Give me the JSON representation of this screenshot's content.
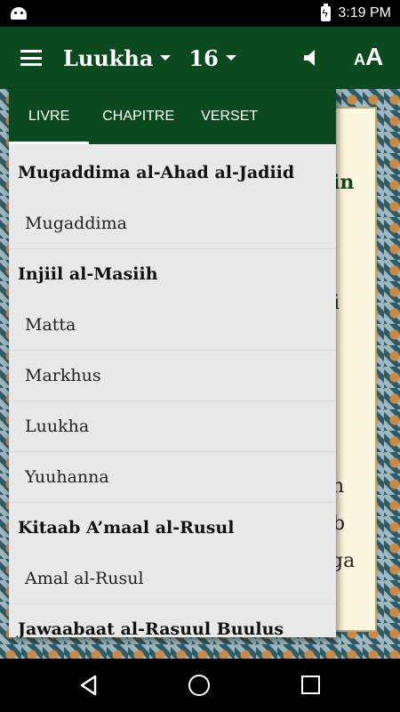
{
  "status_bar": {
    "time": "3:19 PM",
    "icons": [
      "android-icon",
      "battery-charging-icon"
    ]
  },
  "app_bar": {
    "book": "Luukha",
    "chapter": "16",
    "icons": [
      "menu-icon",
      "caret-down-icon",
      "speaker-icon",
      "font-size-icon"
    ],
    "font_icon_small": "A",
    "font_icon_big": "A"
  },
  "tabs": {
    "livre": "LIVRE",
    "chapitre": "CHAPITRE",
    "verset": "VERSET",
    "selected": "LIVRE"
  },
  "book_list": [
    {
      "type": "header",
      "label": "Mugaddima al-Ahad al-Jadiid"
    },
    {
      "type": "item",
      "label": "Mugaddima"
    },
    {
      "type": "header",
      "label": "Injiil al-Masiih"
    },
    {
      "type": "item",
      "label": "Matta"
    },
    {
      "type": "item",
      "label": "Markhus"
    },
    {
      "type": "item",
      "label": "Luukha"
    },
    {
      "type": "item",
      "label": "Yuuhanna"
    },
    {
      "type": "header",
      "label": "Kitaab A’maal al-Rusul"
    },
    {
      "type": "item",
      "label": "Amal al-Rusul"
    },
    {
      "type": "header",
      "label": "Jawaabaat al-Rasuul Buulus"
    }
  ],
  "background_text": {
    "line1": "in",
    "line2": "i",
    "line3": "n",
    "line4": "b",
    "line5": "ga"
  },
  "colors": {
    "accent": "#0b4a1f",
    "panel": "#e8e8e8",
    "paper": "#fdf6de"
  },
  "nav_bar": {
    "icons": [
      "back-icon",
      "home-icon",
      "recents-icon"
    ]
  }
}
